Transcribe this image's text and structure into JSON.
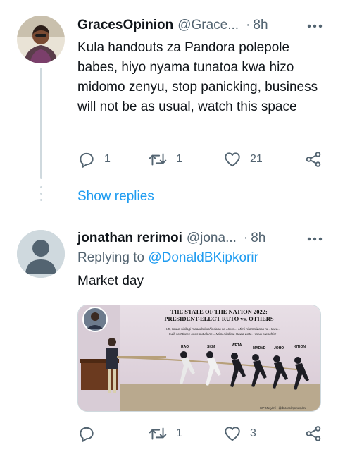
{
  "tweets": [
    {
      "display_name": "GracesOpinion",
      "handle": "@Grace...",
      "separator": "·",
      "time": "8h",
      "text": "Kula handouts za Pandora polepole babes, hiyo nyama tunatoa kwa hizo midomo zenyu, stop panicking, business will not be as usual, watch this space",
      "replies": "1",
      "retweets": "1",
      "likes": "21",
      "show_replies": "Show replies"
    },
    {
      "display_name": "jonathan rerimoi",
      "handle": "@jona...",
      "separator": "·",
      "time": "8h",
      "replying_to_label": "Replying to",
      "replying_to_user": "@DonaldBKipkorir",
      "text": "Market day",
      "replies": "",
      "retweets": "1",
      "likes": "3",
      "media": {
        "title_line1": "THE STATE OF THE NATION 2022:",
        "title_line2": "PRESIDENT-ELECT RUTO vs. OTHERS",
        "caption_line1": "H.E, Hawa sihilagi maaada kushindana na Hawa... Mimi nitamalizana na Hawa...",
        "caption_line2": "I will sort these ones out alone... Mimi nitalima Hawa wote. Hawa niwachie!",
        "labels": [
          "RAO",
          "SKM",
          "WETA",
          "MADVD",
          "JOHO",
          "KITION"
        ],
        "credit": "MP Musyimi - @fb.com/mpmusyimi"
      }
    }
  ],
  "icons": {
    "more": "more-dots-icon",
    "reply": "reply-icon",
    "retweet": "retweet-icon",
    "like": "heart-icon",
    "share": "share-icon"
  },
  "colors": {
    "link_blue": "#1d9bf0",
    "secondary_text": "#536471",
    "primary_text": "#0f1419",
    "divider": "#eff3f4"
  }
}
